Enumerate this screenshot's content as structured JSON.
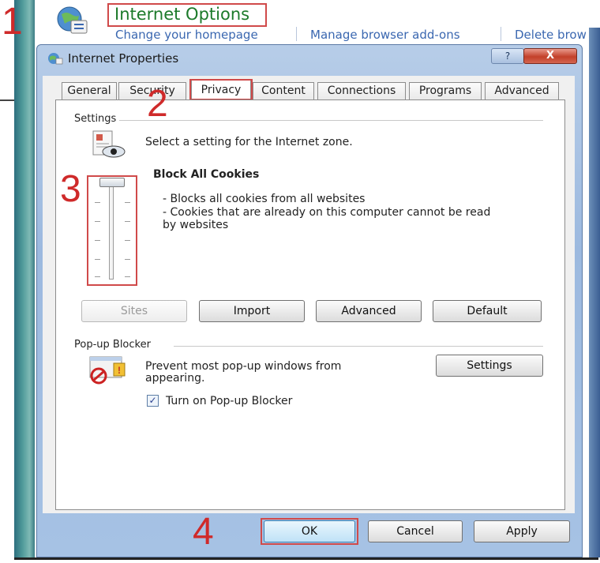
{
  "annotations": {
    "step1": "1",
    "step2": "2",
    "step3": "3",
    "step4": "4"
  },
  "control_panel": {
    "title": "Internet Options",
    "links": [
      "Change your homepage",
      "Manage browser add-ons",
      "Delete brow"
    ]
  },
  "dialog": {
    "title": "Internet Properties",
    "help_btn": "?",
    "close_btn": "X",
    "tabs": [
      "General",
      "Security",
      "Privacy",
      "Content",
      "Connections",
      "Programs",
      "Advanced"
    ],
    "active_tab": "Privacy",
    "settings": {
      "group_label": "Settings",
      "zone_text": "Select a setting for the Internet zone.",
      "level_title": "Block All Cookies",
      "desc": [
        "- Blocks all cookies from all websites",
        "- Cookies that are already on this computer cannot be read",
        "by websites"
      ],
      "slider_level": 1.0
    },
    "buttons": {
      "sites": "Sites",
      "import": "Import",
      "advanced": "Advanced",
      "default": "Default"
    },
    "popup": {
      "group_label": "Pop-up Blocker",
      "line1": "Prevent most pop-up windows from",
      "line2": "appearing.",
      "settings_btn": "Settings",
      "checkbox_label": "Turn on Pop-up Blocker",
      "checkbox_checked": true,
      "check_mark": "✓"
    },
    "footer": {
      "ok": "OK",
      "cancel": "Cancel",
      "apply": "Apply"
    }
  },
  "colors": {
    "annotation_red": "#cf2a2a",
    "title_green": "#1c7a2a",
    "link_blue": "#3a67b0"
  }
}
